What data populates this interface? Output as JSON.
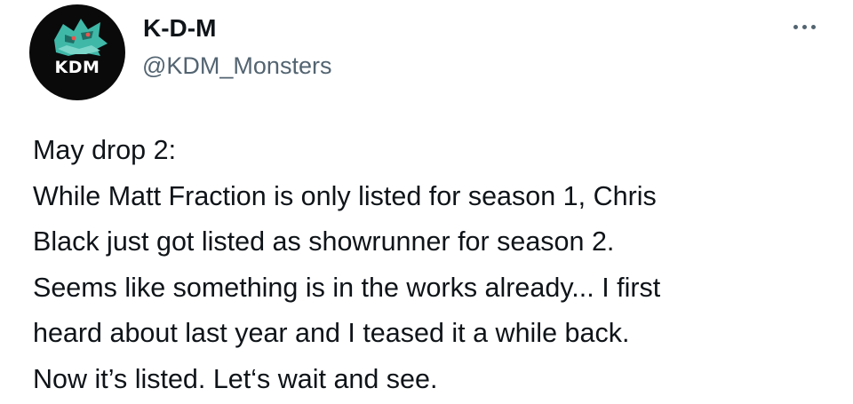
{
  "author": {
    "display_name": "K-D-M",
    "handle": "@KDM_Monsters",
    "avatar_text": "KDM"
  },
  "tweet": {
    "lines": [
      "May drop 2:",
      "While Matt Fraction is only listed for season 1, Chris",
      "Black just got listed as showrunner for season 2.",
      "Seems like something is in the works already... I first",
      "heard about last year and I teased it a while back.",
      "Now it’s listed. Let‘s wait and see."
    ]
  },
  "colors": {
    "text": "#0f1419",
    "secondary_text": "#536471",
    "avatar_background": "#0a0a0a",
    "avatar_accent": "#3fb8a8"
  },
  "icons": {
    "more": "more-dots-icon"
  }
}
